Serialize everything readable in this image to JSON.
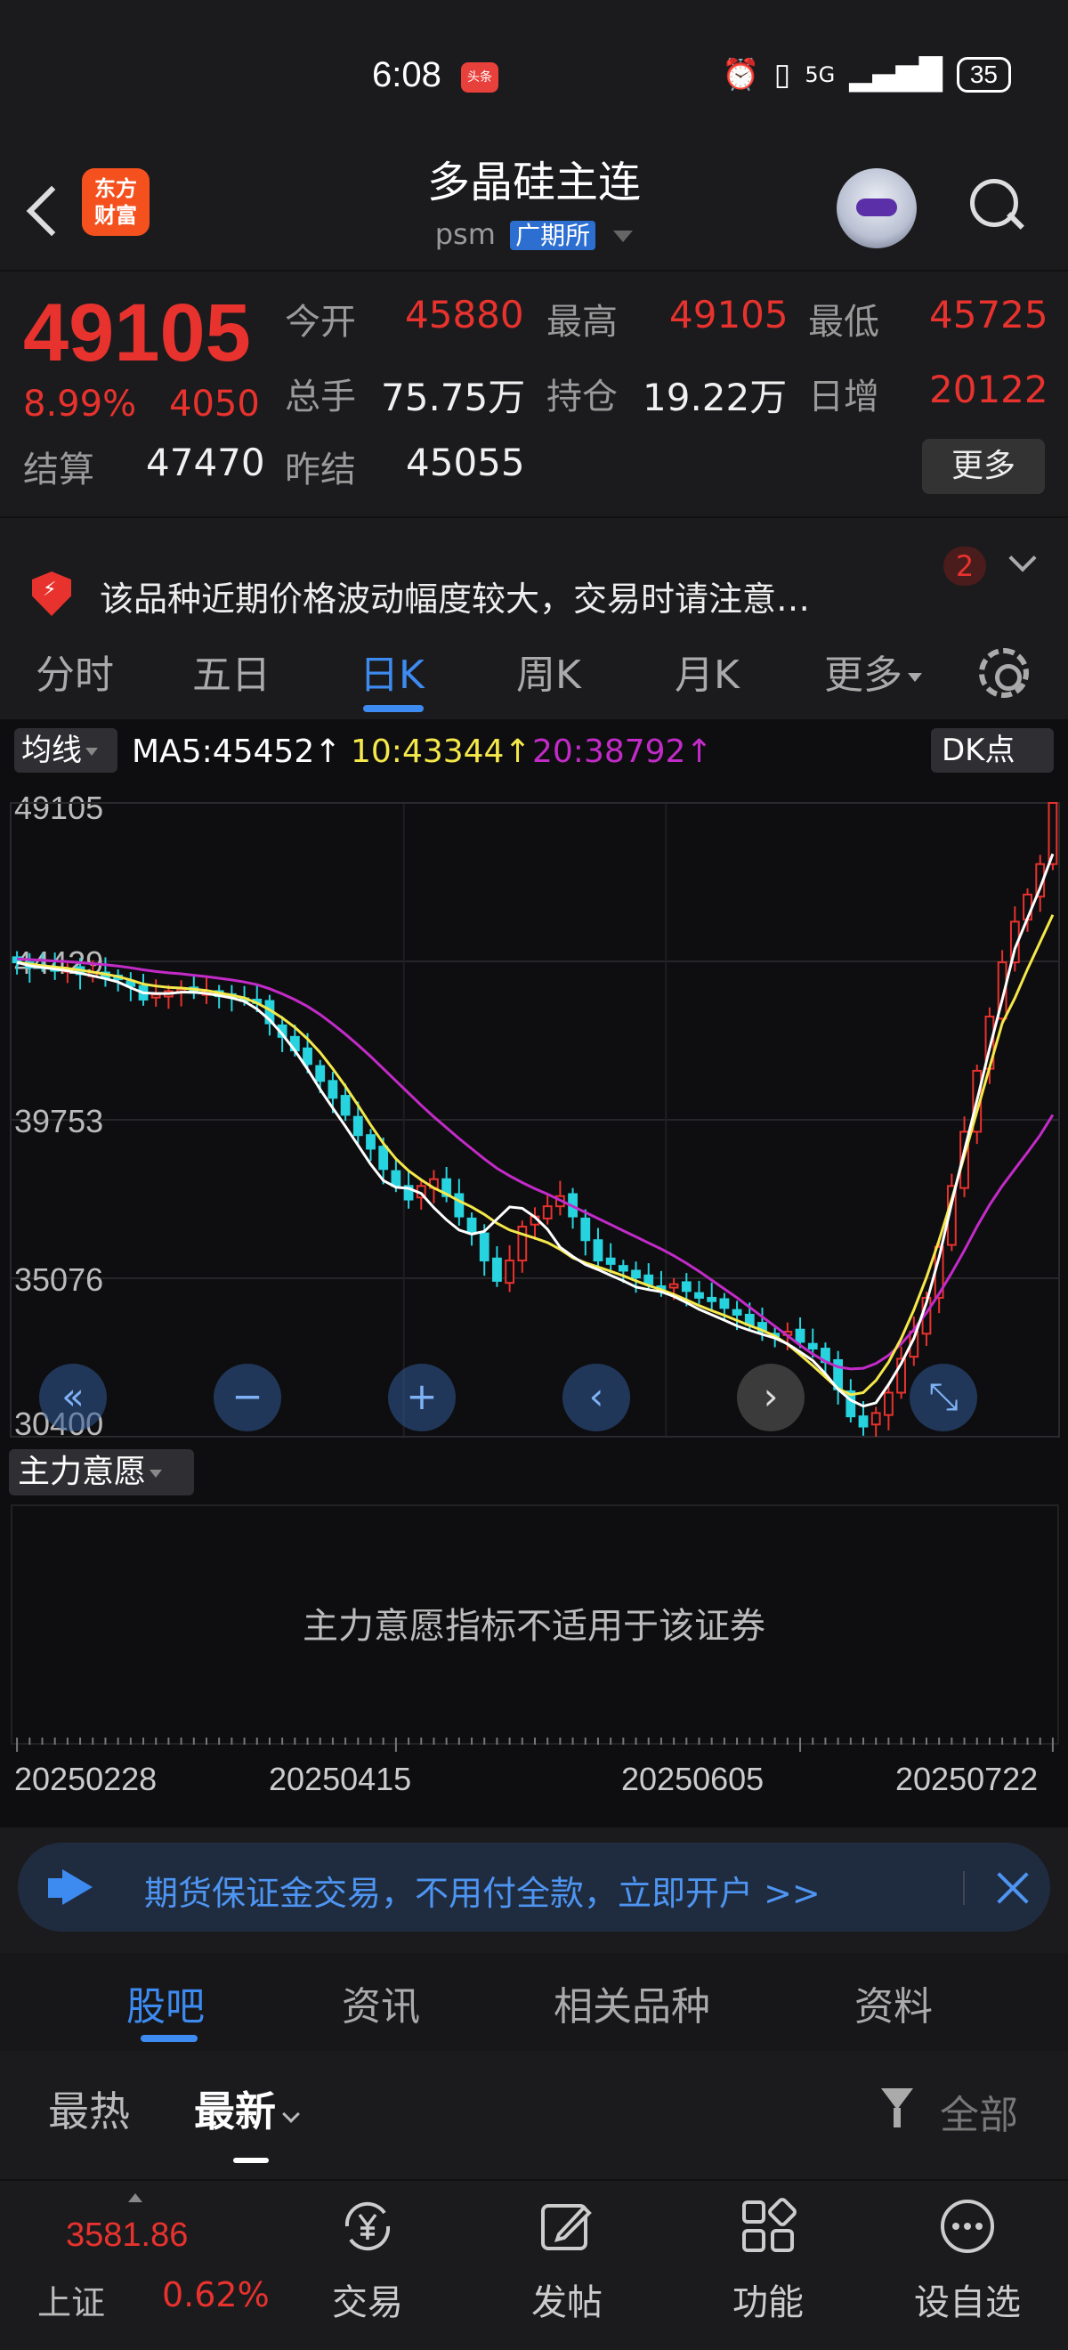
{
  "status_bar": {
    "time": "6:08",
    "news_badge": "头条",
    "network": "5G",
    "battery": "35"
  },
  "header": {
    "title": "多晶硅主连",
    "code": "psm",
    "exchange": "广期所"
  },
  "quote": {
    "price": "49105",
    "change_pct": "8.99%",
    "change": "4050",
    "open_label": "今开",
    "open": "45880",
    "high_label": "最高",
    "high": "49105",
    "low_label": "最低",
    "low": "45725",
    "volume_label": "总手",
    "volume": "75.75万",
    "oi_label": "持仓",
    "oi": "19.22万",
    "daily_inc_label": "日增",
    "daily_inc": "20122",
    "settle_label": "结算",
    "settle": "47470",
    "prev_settle_label": "昨结",
    "prev_settle": "45055",
    "more_label": "更多"
  },
  "alert": {
    "text": "该品种近期价格波动幅度较大，交易时请注意…",
    "badge": "2"
  },
  "period_tabs": {
    "items": [
      "分时",
      "五日",
      "日K",
      "周K",
      "月K",
      "更多"
    ],
    "active": "日K"
  },
  "ma_legend": {
    "toggle": "均线",
    "ma5": "MA5:45452↑",
    "ma10": "10:43344↑",
    "ma20": "20:38792↑",
    "dk": "DK点",
    "colors": {
      "ma5": "#ffffff",
      "ma10": "#f5e84a",
      "ma20": "#c32bc8",
      "up": "#e8322e",
      "down": "#27d3de"
    }
  },
  "chart_data": {
    "type": "candlestick",
    "y_ticks": [
      "49105",
      "44429",
      "39753",
      "35076",
      "30400"
    ],
    "ylim": [
      30400,
      49105
    ],
    "x_ticks": [
      "20250228",
      "20250415",
      "20250605",
      "20250722"
    ],
    "grid": true,
    "close": [
      44400,
      44250,
      44300,
      44150,
      44200,
      44050,
      44100,
      43950,
      43900,
      43700,
      43300,
      43450,
      43550,
      43600,
      43500,
      43550,
      43400,
      43400,
      43300,
      43200,
      42600,
      42200,
      41800,
      41400,
      40900,
      40400,
      39900,
      39300,
      38900,
      38300,
      37800,
      37400,
      37800,
      38000,
      37500,
      36900,
      36400,
      35600,
      35000,
      35600,
      36600,
      36900,
      37200,
      37500,
      36900,
      36200,
      35600,
      35500,
      35300,
      35100,
      34900,
      34800,
      34900,
      34700,
      34500,
      34400,
      34200,
      34000,
      33700,
      33500,
      33400,
      33500,
      33200,
      33000,
      32600,
      31800,
      31000,
      30700,
      31100,
      31700,
      32700,
      33500,
      34500,
      36000,
      37800,
      39400,
      41200,
      42800,
      44400,
      45600,
      46400,
      47300,
      49105
    ],
    "ma5": [
      44400,
      44300,
      44250,
      44200,
      44150,
      44080,
      44000,
      43920,
      43820,
      43650,
      43500,
      43480,
      43480,
      43520,
      43520,
      43480,
      43420,
      43350,
      43250,
      43020,
      42700,
      42280,
      41800,
      41250,
      40650,
      40100,
      39560,
      39000,
      38440,
      37960,
      37760,
      37730,
      37580,
      37160,
      36800,
      36500,
      36380,
      36460,
      36820,
      37180,
      37140,
      36880,
      36520,
      35990,
      35720,
      35480,
      35330,
      35160,
      35000,
      34820,
      34740,
      34680,
      34540,
      34360,
      34160,
      34000,
      33840,
      33670,
      33540,
      33420,
      33310,
      33140,
      32900,
      32650,
      32260,
      31800,
      31480,
      31300,
      31400,
      31940,
      32560,
      33300,
      34360,
      35700,
      37300,
      38840,
      40320,
      41860,
      43300,
      44800,
      45700,
      46600,
      47600
    ],
    "ma10": [
      44400,
      44350,
      44300,
      44260,
      44220,
      44170,
      44110,
      44050,
      43980,
      43880,
      43760,
      43700,
      43660,
      43640,
      43610,
      43570,
      43500,
      43430,
      43350,
      43200,
      43000,
      42760,
      42480,
      42140,
      41740,
      41260,
      40740,
      40180,
      39600,
      39060,
      38600,
      38250,
      37980,
      37740,
      37560,
      37360,
      37180,
      36960,
      36700,
      36500,
      36380,
      36260,
      36130,
      35930,
      35680,
      35530,
      35410,
      35280,
      35150,
      35000,
      34860,
      34740,
      34600,
      34440,
      34270,
      34120,
      33980,
      33830,
      33680,
      33540,
      33370,
      33130,
      32820,
      32500,
      32160,
      31820,
      31640,
      31700,
      32060,
      32600,
      33300,
      34140,
      35100,
      36200,
      37400,
      38700,
      40000,
      41300,
      42600,
      43344,
      44200,
      45000,
      45800
    ],
    "ma20": [
      44500,
      44480,
      44460,
      44440,
      44420,
      44390,
      44360,
      44330,
      44290,
      44240,
      44180,
      44130,
      44090,
      44060,
      44020,
      43980,
      43930,
      43880,
      43820,
      43740,
      43620,
      43470,
      43300,
      43100,
      42860,
      42580,
      42280,
      41960,
      41620,
      41260,
      40900,
      40540,
      40180,
      39840,
      39520,
      39200,
      38900,
      38600,
      38320,
      38100,
      37900,
      37720,
      37560,
      37380,
      37200,
      37020,
      36840,
      36660,
      36480,
      36300,
      36120,
      35940,
      35740,
      35520,
      35280,
      35020,
      34760,
      34500,
      34220,
      33940,
      33660,
      33380,
      33100,
      32840,
      32620,
      32460,
      32400,
      32420,
      32560,
      32800,
      33140,
      33560,
      34060,
      34620,
      35240,
      35900,
      36600,
      37240,
      37800,
      38300,
      38792,
      39300,
      39900
    ]
  },
  "controls": [
    "«",
    "−",
    "+",
    "‹",
    "›",
    "⤡"
  ],
  "indicator": {
    "name": "主力意愿",
    "message": "主力意愿指标不适用于该证券"
  },
  "promo": {
    "text": "期货保证金交易，不用付全款，立即开户 >>"
  },
  "community_tabs": {
    "items": [
      "股吧",
      "资讯",
      "相关品种",
      "资料"
    ],
    "active": "股吧"
  },
  "sort": {
    "hot": "最热",
    "new": "最新",
    "filter": "全部"
  },
  "bottom_nav": {
    "index_value": "3581.86",
    "index_name": "上证",
    "index_pct": "0.62%",
    "items": [
      {
        "label": "交易",
        "icon": "yuan-exchange-icon"
      },
      {
        "label": "发帖",
        "icon": "edit-icon"
      },
      {
        "label": "功能",
        "icon": "grid-icon"
      },
      {
        "label": "设自选",
        "icon": "more-circle-icon"
      }
    ]
  }
}
